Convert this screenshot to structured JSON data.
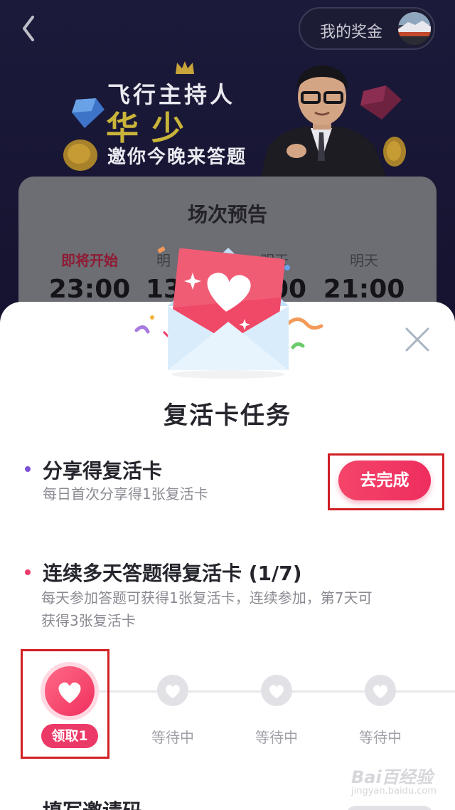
{
  "header": {
    "prize_label": "我的奖金"
  },
  "banner": {
    "line1": "飞行主持人",
    "host_name": "华少",
    "line3": "邀你今晚来答题"
  },
  "schedule": {
    "title": "场次预告",
    "slots": [
      {
        "label": "即将开始",
        "time": "23:00",
        "active": true
      },
      {
        "label": "明",
        "time": "13",
        "active": false
      },
      {
        "label": "明天",
        "time": "00",
        "active": false
      },
      {
        "label": "明天",
        "time": "21:00",
        "active": false
      }
    ]
  },
  "sheet": {
    "title": "复活卡任务",
    "tasks": [
      {
        "title": "分享得复活卡",
        "desc": "每日首次分享得1张复活卡",
        "button": "去完成",
        "dot_color": "#7b52d6"
      },
      {
        "title": "连续多天答题得复活卡 (1/7)",
        "desc_line1": "每天参加答题可获得1张复活卡，连续参加，第7天可",
        "desc_line2": "获得3张复活卡",
        "dot_color": "#ec3a68"
      }
    ],
    "progress_steps": [
      {
        "label": "领取1",
        "state": "claimable"
      },
      {
        "label": "等待中",
        "state": "waiting"
      },
      {
        "label": "等待中",
        "state": "waiting"
      },
      {
        "label": "等待中",
        "state": "waiting"
      }
    ],
    "next_task_title": "填写邀请码"
  },
  "watermark": {
    "text": "Bai百经验",
    "sub": "jingyan.baidu.com"
  },
  "colors": {
    "accent": "#ee2d5e",
    "highlight_box": "#d01f23"
  }
}
